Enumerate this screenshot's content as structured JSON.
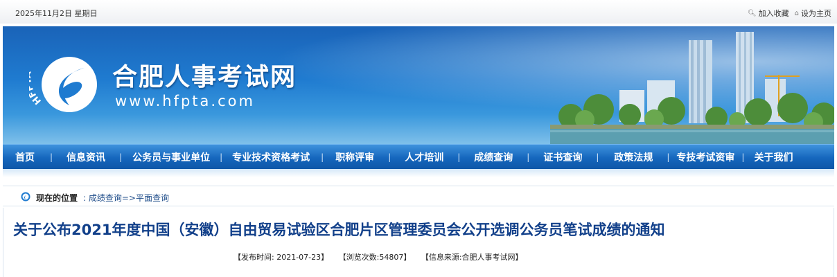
{
  "topbar": {
    "date": "2025年11月2日 星期日",
    "links": [
      {
        "icon": "search-icon",
        "label": "加入收藏"
      },
      {
        "icon": "home-icon",
        "label": "设为主页"
      }
    ]
  },
  "banner": {
    "logo_text": "HFPTA",
    "site_title": "合肥人事考试网",
    "site_url": "www.hfpta.com"
  },
  "nav": {
    "items": [
      "首页",
      "信息资讯",
      "公务员与事业单位",
      "专业技术资格考试",
      "职称评审",
      "人才培训",
      "成绩查询",
      "证书查询",
      "政策法规",
      "专技考试资审",
      "关于我们"
    ],
    "separator": "|"
  },
  "breadcrumb": {
    "label": "现在的位置",
    "path": ": 成绩查询=>平面查询"
  },
  "article": {
    "title": "关于公布2021年度中国（安徽）自由贸易试验区合肥片区管理委员会公开选调公务员笔试成绩的通知",
    "publish_time": "【发布时间: 2021-07-23】",
    "views": "【浏览次数:54807】",
    "source": "【信息来源:合肥人事考试网】"
  }
}
